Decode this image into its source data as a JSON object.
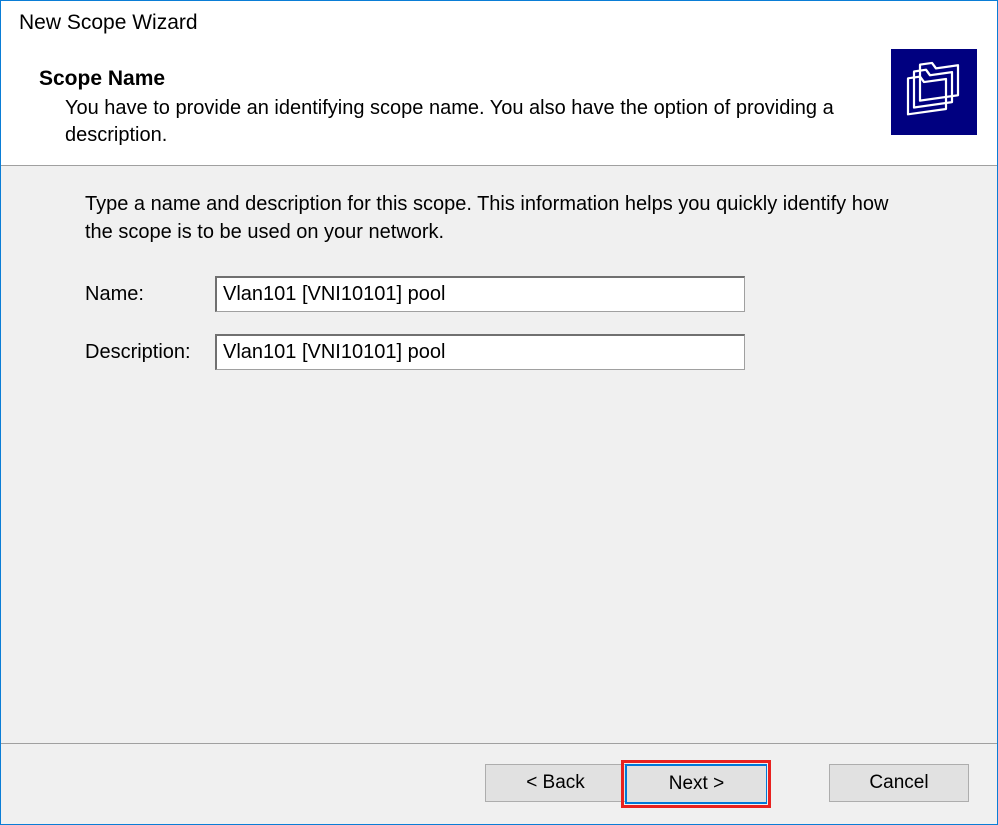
{
  "titlebar": "New Scope Wizard",
  "header": {
    "title": "Scope Name",
    "subtitle": "You have to provide an identifying scope name. You also have the option of providing a description."
  },
  "content": {
    "instructions": "Type a name and description for this scope. This information helps you quickly identify how the scope is to be used on your network.",
    "name_label": "Name:",
    "name_value": "Vlan101 [VNI10101] pool",
    "description_label": "Description:",
    "description_value": "Vlan101 [VNI10101] pool"
  },
  "footer": {
    "back": "< Back",
    "next": "Next >",
    "cancel": "Cancel"
  }
}
